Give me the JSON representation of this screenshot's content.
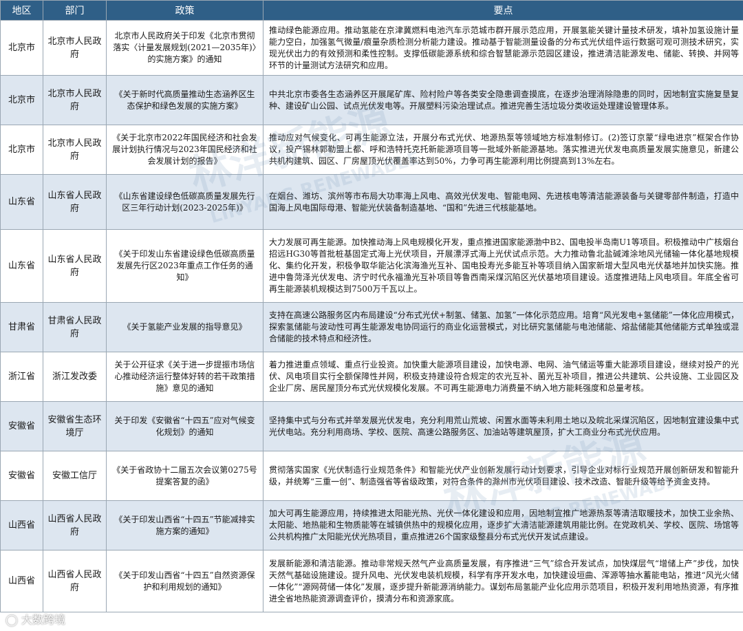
{
  "headers": {
    "region": "地区",
    "dept": "部门",
    "policy": "政策",
    "points": "要点"
  },
  "rows": [
    {
      "region": "北京市",
      "dept": "北京市人民政府",
      "policy": "北京市人民政府关于印发《北京市贯彻落实〈计量发展规划(2021—2035年)〉的实施方案》的通知",
      "points": "推动绿色能源应用。推动氢能在京津冀燃料电池汽车示范城市群开展示范应用，开展氢能关键计量技术研发，填补加氢设施计量能力空白，加强氢气微量/痕量杂质检测分析能力建设。推动基于智能测量设备的分布式光伏组件运行数据可观可测技术研究，实现光伏出力的有效预测和柔性控制。支撑低碳能源系统和综合智慧能源示范园区建设，推进清洁能源发电、储能、转换、并网等环节的计量测试方法研究和应用。"
    },
    {
      "region": "北京市",
      "dept": "北京市人民政府",
      "policy": "《关于新时代高质量推动生态涵养区生态保护和绿色发展的实施方案》",
      "points": "中共北京市委各生态涵养区开展尾矿库、险村险户等各类安全隐患调查摸底，在逐步治理消除隐患的同时，因地制宜实施复垦复种、建设矿山公园、试点光伏发电等。开展塑料污染治理试点。推进完善生活垃圾分类收运处理建设管理体系。"
    },
    {
      "region": "北京市",
      "dept": "北京市人民政府",
      "policy": "《关于北京市2022年国民经济和社会发展计划执行情况与2023年国民经济和社会发展计划的报告》",
      "points": "推动应对气候变化、可再生能源立法，开展分布式光伏、地源热泵等领域地方标准制修订。(2)签订京蒙“绿电进京”框架合作协议，投产锡林郭勒盟上都、呼和浩特托克托新能源项目等一批域外新能源基地。落实推进光伏发电高质量发展实施意见，新建公共机构建筑、园区、厂房屋顶光伏覆盖率达到50%，力争可再生能源利用比例提高到13%左右。"
    },
    {
      "region": "山东省",
      "dept": "山东省人民政府",
      "policy": "《山东省建设绿色低碳高质量发展先行区三年行动计划(2023-2025年)》",
      "points": "在烟台、潍坊、滨州等市布局大功率海上风电、高效光伏发电、智能电网、先进核电等清洁能源装备与关键零部件制造，打造中国海上风电国际母港、智能光伏装备制造基地、“国和”先进三代核能基地。"
    },
    {
      "region": "山东省",
      "dept": "山东省人民政府",
      "policy": "《关于印发山东省建设绿色低碳高质量发展先行区2023年重点工作任务的通知》",
      "points": "大力发展可再生能源。加快推动海上风电规模化开发，重点推进国家能源渤中B2、国电投半岛南U1等项目。积极推动中广核烟台招远HG30等首批桩基固定式海上光伏项目，开展漂浮式海上光伏试点示范。大力推动鲁北盐碱滩涂地风光储输一体化基地规模化、集约化开发，积极争取华能沾化滨海渔光互补、国电投寿光多能互补等项目纳入国家新增大型风电光伏基地并加快实施。推进中鲁菏泽光伏发电、济宁时代永福渔光互补项目等鲁西南采煤沉陷区光伏基地项目建设。适度推进陆上风电项目。年底全省可再生能源装机规模达到7500万千瓦以上。"
    },
    {
      "region": "甘肃省",
      "dept": "甘肃省人民政府",
      "policy": "《关于氢能产业发展的指导意见》",
      "points": "支持在高速公路服务区内布局建设“分布式光伏+制氢、储氢、加氢”一体化示范应用。培育“风光发电+氢储能”一体化应用模式，探索氢储能与波动性可再生能源发电协同运行的商业化运营模式，对比研究氢储能与电池储能、熔盐储能其他储能方式单独或混合储能的技术特点和经济性。"
    },
    {
      "region": "浙江省",
      "dept": "浙江发改委",
      "policy": "关于公开征求《关于进一步提振市场信心推动经济运行整体好转的若干政策措施》意见的通知",
      "points": "着力推进重点领域、重点行业投资。加快重大能源项目建设，加快电源、电网、油气储运等重大能源项目建设，继续对投产的光伏、风电项目实行全额保障性并网，积极支持建设符合规定的农光互补、菌光互补项目，推进公共建筑、公共设施、工业园区及企业厂房、居民屋顶分布式光伏规模化发展。不可再生能源电力消费量不纳入地方能耗强度和总量考核。"
    },
    {
      "region": "安徽省",
      "dept": "安徽省生态环境厅",
      "policy": "关于印发《安徽省“十四五”应对气候变化规划》的通知",
      "points": "坚持集中式与分布式并举发展光伏发电，充分利用荒山荒坡、闲置水面等未利用土地以及皖北采煤沉陷区，因地制宜建设集中式光伏电站。充分利用商场、学校、医院、高速公路服务区、加油站等建筑屋顶，扩大工商业分布式光伏应用。"
    },
    {
      "region": "安徽省",
      "dept": "安徽工信厅",
      "policy": "《关于省政协十二届五次会议第0275号提案答复的函》",
      "points": "贯彻落实国家《光伏制造行业规范条件》和智能光伏产业创新发展行动计划要求，引导企业对标行业规范开展创新研发和智能升级，并统筹“三重一创”、制造强省等省级政策，对符合条件的滁州市光伏项目建设、技术改造、智能升级等给予资金支持。"
    },
    {
      "region": "山西省",
      "dept": "山西省人民政府",
      "policy": "《关于印发山西省“十四五”节能减排实施方案的通知》",
      "points": "加大可再生能源应用，持续推进太阳能光热、光伏一体化建设和应用，因地制宜推广地源热泵等清洁取暖技术，加快工业余热、太阳能、地热能和生物质能等在城镇供热中的规模化应用，逐步扩大清洁能源建筑用能比例。在党政机关、学校、医院、场馆等公共机构推广太阳能光伏光热项目，重点推进26个国家级整县分布式光伏开发试点建设。"
    },
    {
      "region": "山西省",
      "dept": "山西省人民政府",
      "policy": "《关于印发山西省“十四五”自然资源保护和利用规划的通知》",
      "points": "发展新能源和清洁能源。推动非常规天然气产业高质量发展，有序推进“三气”综合开发试点，加快煤层气“增储上产”步伐，加快天然气基础设施建设。提升风电、光伏发电装机规模，科学有序开发水电，加快建设垣曲、浑源等抽水蓄能电站，推进“风光火储一体化”“源网荷储一体化”发展，逐步提升新能源消纳能力。谋划布局氢能产业化应用示范项目，积极开发利用地热资源，有序推进全省地热能资源调查评价，摸清分布和资源家底。"
    }
  ],
  "watermark": {
    "main_cn": "林洋新能源",
    "main_en": "LINYANG RENEWABLE"
  },
  "logo_text": "大数跨境"
}
